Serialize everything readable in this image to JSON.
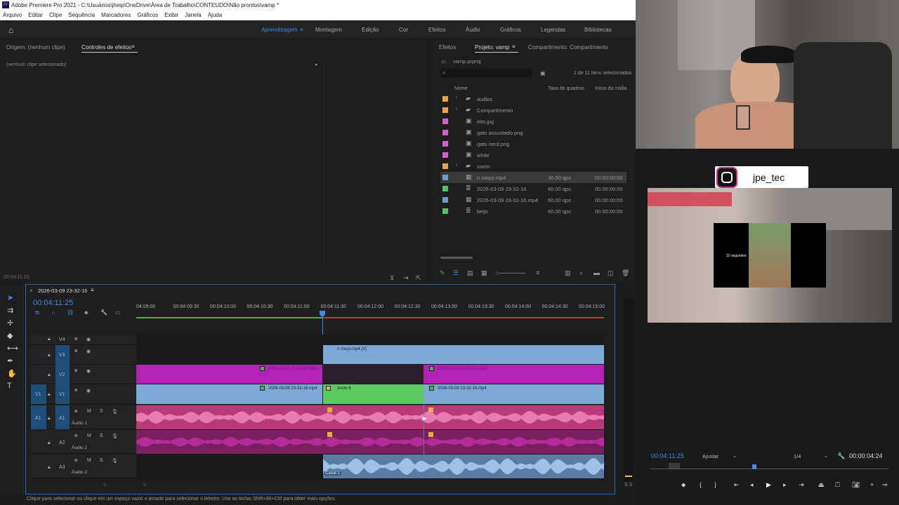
{
  "window": {
    "title": "Adobe Premiere Pro 2021 - C:\\Usuários\\jheip\\OneDrive\\Área de Trabalho\\CONTEUDO\\Não prontos\\vamp *"
  },
  "menu": [
    "Arquivo",
    "Editar",
    "Clipe",
    "Sequência",
    "Marcadores",
    "Gráficos",
    "Exibir",
    "Janela",
    "Ajuda"
  ],
  "workspaces": [
    {
      "label": "Aprendizagem",
      "active": true
    },
    {
      "label": "Montagem",
      "active": false
    },
    {
      "label": "Edição",
      "active": false
    },
    {
      "label": "Cor",
      "active": false
    },
    {
      "label": "Efeitos",
      "active": false
    },
    {
      "label": "Áudio",
      "active": false
    },
    {
      "label": "Gráficos",
      "active": false
    },
    {
      "label": "Legendas",
      "active": false
    },
    {
      "label": "Bibliotecas",
      "active": false
    }
  ],
  "source_panel": {
    "tab_origin": "Origem: (nenhum clipe)",
    "tab_effects": "Controles de efeitos",
    "no_clip": "(nenhum clipe selecionado)",
    "timecode": "00:04:11:25"
  },
  "project_panel": {
    "tab_effects": "Efeitos",
    "tab_project": "Projeto: vamp",
    "tab_share": "Compartimento: Compartimento",
    "file": "vamp.prproj",
    "search_placeholder": "",
    "selection_count": "1 de 11 itens selecionados",
    "col_name": "Nome",
    "col_rate": "Taxa de quadros",
    "col_start": "Início da mídia",
    "items": [
      {
        "name": "audios",
        "rate": "",
        "start": "",
        "color": "#e8a33c",
        "icon": "folder-icon",
        "expandable": true
      },
      {
        "name": "Compartimento",
        "rate": "",
        "start": "",
        "color": "#e8a33c",
        "icon": "folder-icon",
        "expandable": true
      },
      {
        "name": "eita.jpg",
        "rate": "",
        "start": "",
        "color": "#d561c8",
        "icon": "image-icon",
        "expandable": false
      },
      {
        "name": "gato assustado.png",
        "rate": "",
        "start": "",
        "color": "#d561c8",
        "icon": "image-icon",
        "expandable": false
      },
      {
        "name": "gato nerd.png",
        "rate": "",
        "start": "",
        "color": "#d561c8",
        "icon": "image-icon",
        "expandable": false
      },
      {
        "name": "white",
        "rate": "",
        "start": "",
        "color": "#d561c8",
        "icon": "image-icon",
        "expandable": false
      },
      {
        "name": "zoom",
        "rate": "",
        "start": "",
        "color": "#e8a33c",
        "icon": "folder-icon",
        "expandable": true
      },
      {
        "name": "n moço.mp4",
        "rate": "30,00 qps",
        "start": "00:00:00:00",
        "color": "#6d9bd4",
        "icon": "film-icon",
        "expandable": false,
        "selected": true
      },
      {
        "name": "2026-03-09 23-32-16",
        "rate": "60,00 qps",
        "start": "00:00:00:00",
        "color": "#4fc463",
        "icon": "sequence-icon",
        "expandable": false
      },
      {
        "name": "2026-03-09 23-32-16.mp4",
        "rate": "60,00 qps",
        "start": "00:00:00:00",
        "color": "#6d9bd4",
        "icon": "film-icon",
        "expandable": false
      },
      {
        "name": "beijo",
        "rate": "60,00 qps",
        "start": "00:00:00:00",
        "color": "#4fc463",
        "icon": "sequence-icon",
        "expandable": false
      }
    ]
  },
  "timeline": {
    "sequence_tab": "2026-03-09 23-32-16",
    "timecode": "00:04:11:25",
    "ruler": [
      "04:09:00",
      "00:04:09:30",
      "00:04:10:00",
      "00:04:10:30",
      "00:04:11:00",
      "00:04:11:30",
      "00:04:12:00",
      "00:04:12:30",
      "00:04:13:00",
      "00:04:13:30",
      "00:04:14:00",
      "00:04:14:30",
      "00:04:15:00"
    ],
    "tracks": {
      "v4": "V4",
      "v3": "V3",
      "v2": "V2",
      "v1": "V1",
      "v1src": "V1",
      "a1": "A1",
      "a1src": "A1",
      "a2": "A2",
      "a3": "A3",
      "a1_name": "Áudio 1",
      "a2_name": "Áudio 2",
      "a3_name": "Áudio 3"
    },
    "clips": {
      "v3_clip": "n moço.mp4 [V]",
      "v2_left": "2026-03-09 23-32-16.mp4",
      "v2_right": "2026-03-09 23-32-16.mp4",
      "v1_left": "2026-03-09 23-32-16.mp4",
      "v1_zoom": "zoom 6",
      "v1_right": "2026-03-09 23-32-16.mp4",
      "a3_label": "Canal 1"
    },
    "m": "M",
    "s": "S"
  },
  "status_hint": "Clique para selecionar ou clique em um espaço vazio e arraste para selecionar o letreiro. Use as teclas Shift+Alt+Ctrl para obter mais opções.",
  "program": {
    "instagram": "jpe_tec",
    "overlay_text": "10 segundos",
    "timecode": "00:04:11:25",
    "fit": "Ajustar",
    "quality": "1/4",
    "duration": "00:00:04:24"
  },
  "colors": {
    "accent": "#3c8ce7",
    "video_clip": "#7ea8d8",
    "pink_clip": "#b321b5",
    "green_clip": "#5ccb5f",
    "audio_pink": "#c2407a"
  }
}
